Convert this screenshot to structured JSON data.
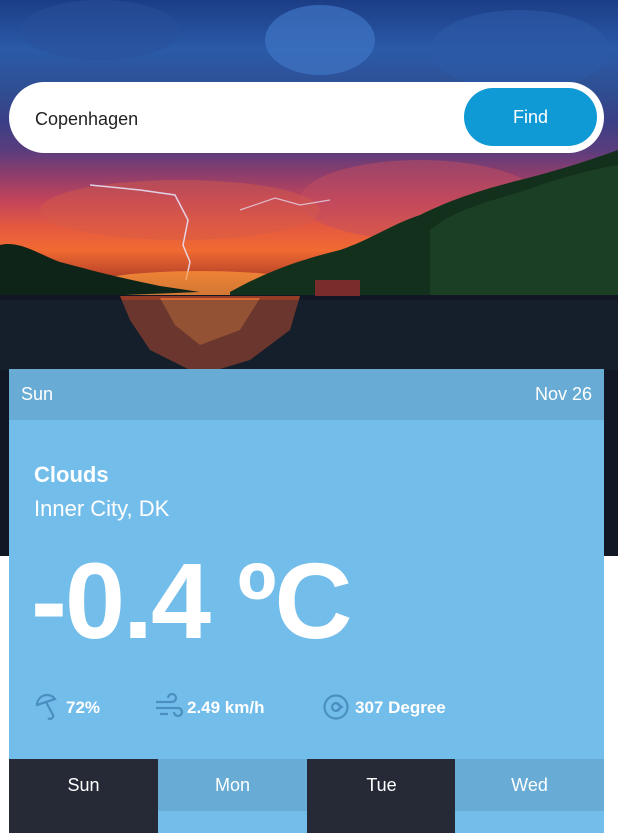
{
  "search": {
    "value": "Copenhagen",
    "button_label": "Find"
  },
  "card": {
    "day": "Sun",
    "date": "Nov 26",
    "condition": "Clouds",
    "location": "Inner City, DK",
    "temperature": "-0.4 ºC",
    "humidity": "72%",
    "wind": "2.49 km/h",
    "direction": "307 Degree"
  },
  "forecast": {
    "tabs": [
      "Sun",
      "Mon",
      "Tue",
      "Wed"
    ]
  },
  "icons": {
    "humidity": "umbrella-icon",
    "wind": "wind-icon",
    "direction": "compass-icon"
  },
  "colors": {
    "find_button": "#0f9ad6",
    "card": "#73bdeb",
    "card_header": "#68acd6",
    "tab_dark": "#252a36"
  }
}
